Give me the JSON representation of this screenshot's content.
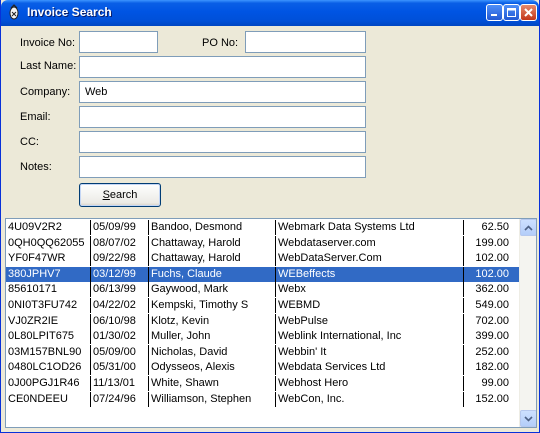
{
  "window": {
    "title": "Invoice Search"
  },
  "form": {
    "invoice_no": {
      "label": "Invoice No:",
      "value": ""
    },
    "po_no": {
      "label": "PO No:",
      "value": ""
    },
    "last_name": {
      "label": "Last Name:",
      "value": ""
    },
    "company": {
      "label": "Company:",
      "value": "Web"
    },
    "email": {
      "label": "Email:",
      "value": ""
    },
    "cc": {
      "label": "CC:",
      "value": ""
    },
    "notes": {
      "label": "Notes:",
      "value": ""
    },
    "search_button": {
      "accel": "S",
      "rest": "earch"
    }
  },
  "results": {
    "selected_index": 3,
    "rows": [
      [
        "4U09V2R2",
        "05/09/99",
        "Bandoo, Desmond",
        "Webmark Data Systems Ltd",
        "62.50"
      ],
      [
        "0QH0QQ62055",
        "08/07/02",
        "Chattaway, Harold",
        "Webdataserver.com",
        "199.00"
      ],
      [
        "YF0F47WR",
        "09/22/98",
        "Chattaway, Harold",
        "WebDataServer.Com",
        "102.00"
      ],
      [
        "380JPHV7",
        "03/12/99",
        "Fuchs, Claude",
        "WEBeffects",
        "102.00"
      ],
      [
        "85610171",
        "06/13/99",
        "Gaywood, Mark",
        "Webx",
        "362.00"
      ],
      [
        "0NI0T3FU742",
        "04/22/02",
        "Kempski, Timothy S",
        "WEBMD",
        "549.00"
      ],
      [
        "VJ0ZR2IE",
        "06/10/98",
        "Klotz, Kevin",
        "WebPulse",
        "702.00"
      ],
      [
        "0L80LPIT675",
        "01/30/02",
        "Muller, John",
        "Weblink International, Inc",
        "399.00"
      ],
      [
        "03M157BNL90",
        "05/09/00",
        "Nicholas, David",
        "Webbin' It",
        "252.00"
      ],
      [
        "0480LC1OD26",
        "05/31/00",
        "Odysseos, Alexis",
        "Webdata Services Ltd",
        "182.00"
      ],
      [
        "0J00PGJ1R46",
        "11/13/01",
        "White, Shawn",
        "Webhost Hero",
        "99.00"
      ],
      [
        "CE0NDEEU",
        "07/24/96",
        "Williamson, Stephen",
        "WebCon, Inc.",
        "152.00"
      ]
    ]
  }
}
